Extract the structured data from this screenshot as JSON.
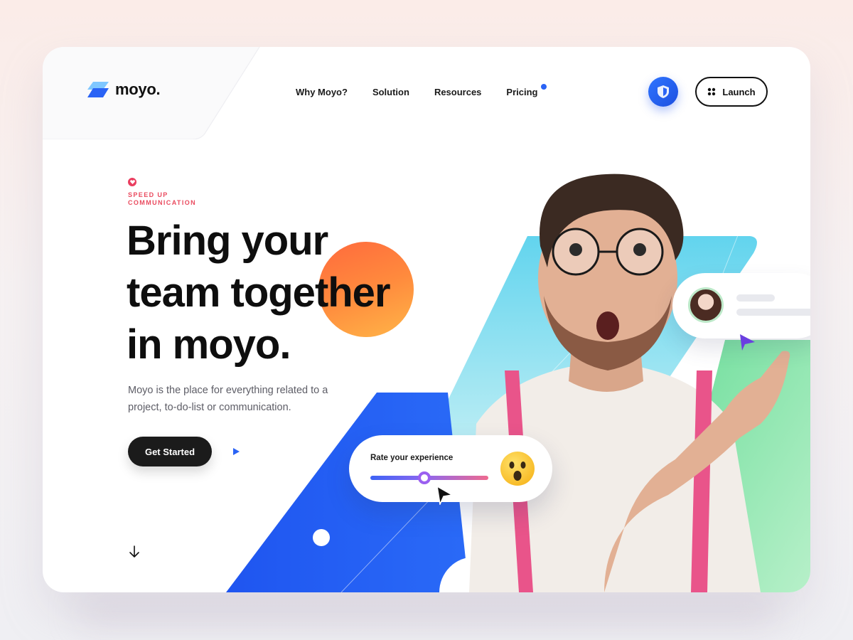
{
  "brand": {
    "name": "moyo."
  },
  "nav": {
    "items": [
      {
        "label": "Why Moyo?"
      },
      {
        "label": "Solution"
      },
      {
        "label": "Resources"
      },
      {
        "label": "Pricing"
      }
    ]
  },
  "header": {
    "launch_label": "Launch"
  },
  "hero": {
    "eyebrow": "SPEED UP COMMUNICATION",
    "headline": [
      "Bring your",
      "team together",
      "in moyo."
    ],
    "description": "Moyo is the place for everything related to a project, to-do-list or communication.",
    "cta_label": "Get Started"
  },
  "rating": {
    "label": "Rate your experience",
    "level_fraction": 0.46
  },
  "colors": {
    "accent_blue": "#2a63f5",
    "eyebrow_red": "#ea4b5f",
    "orange": "#ff7a3d",
    "cyan": "#6dd7ee",
    "green": "#7fe3a4",
    "dark": "#1b1b1b"
  },
  "icons": {
    "logo": "logo-mark-icon",
    "shield": "shield-icon",
    "launch": "grid-dots-icon",
    "heart": "heart-icon",
    "play": "play-icon",
    "scroll": "arrow-down-icon",
    "emoji": "surprised-face-icon"
  }
}
